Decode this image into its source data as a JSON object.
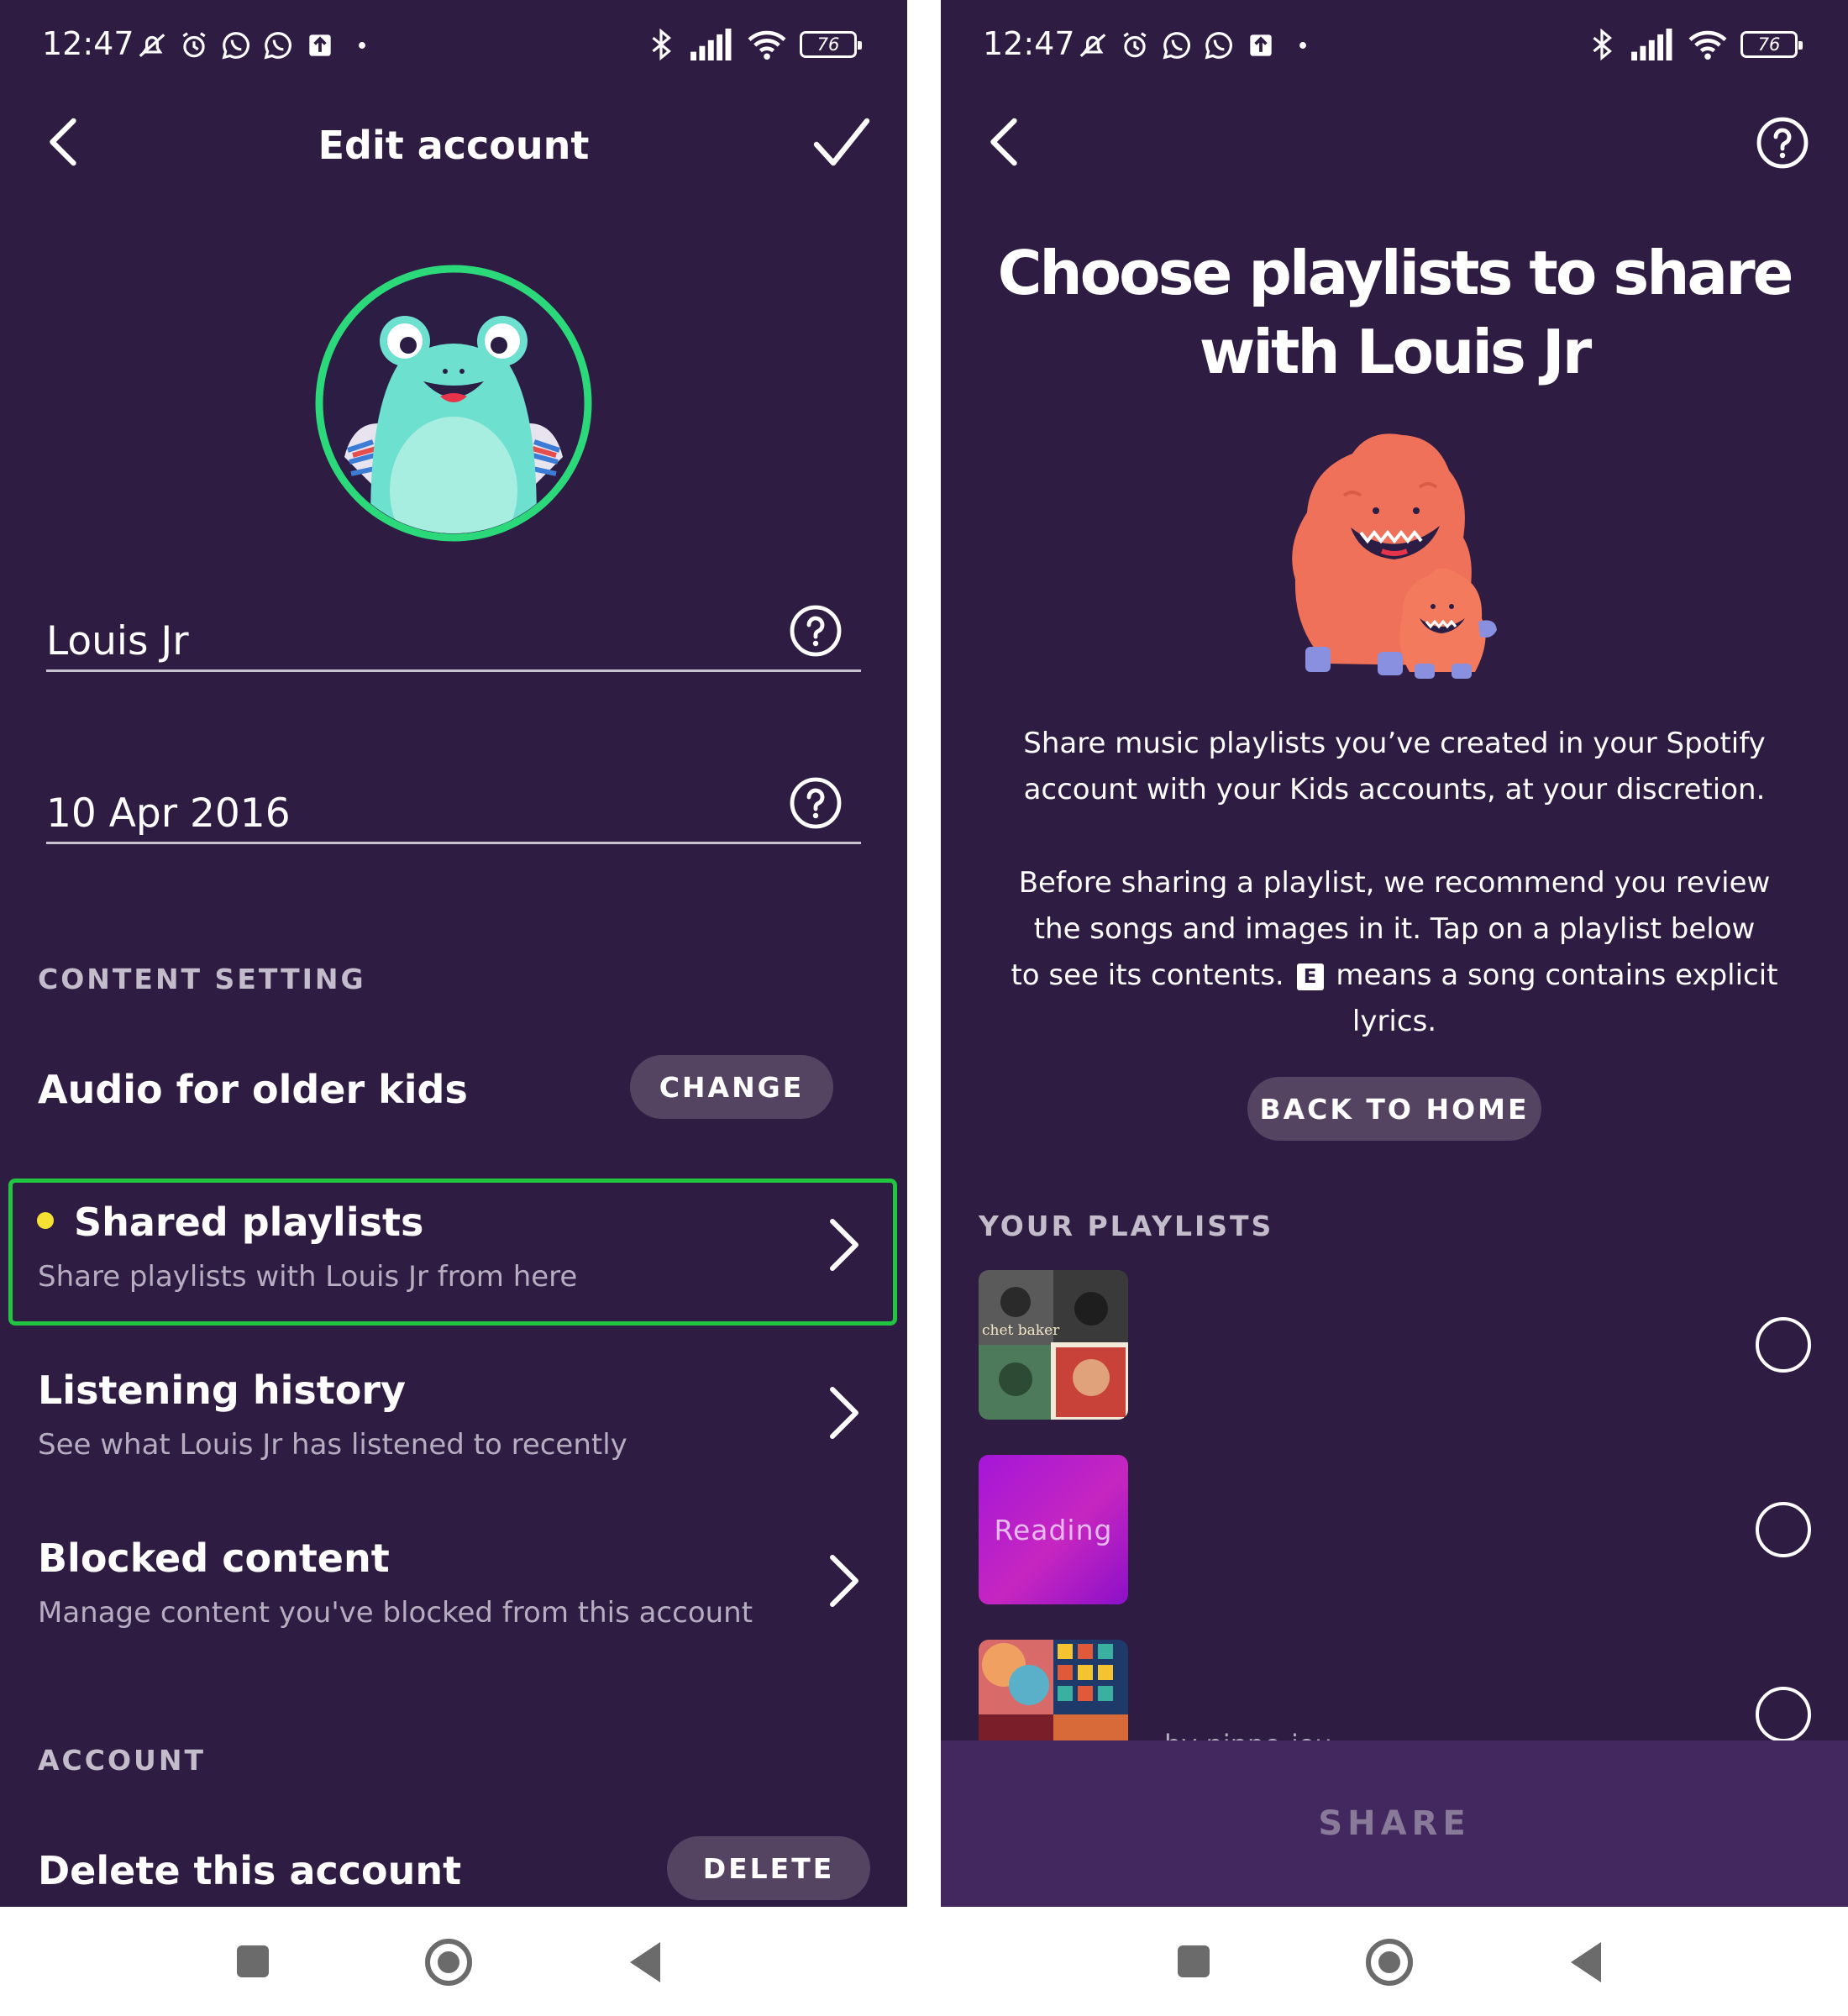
{
  "status_bar": {
    "time": "12:47",
    "battery": "76"
  },
  "edit_account": {
    "title": "Edit account",
    "name_value": "Louis Jr",
    "birthdate_value": "10 Apr 2016",
    "content_setting_header": "CONTENT SETTING",
    "content_level_label": "Audio for older kids",
    "change_button": "CHANGE",
    "shared_playlists": {
      "title": "Shared playlists",
      "subtitle": "Share playlists with Louis Jr from here"
    },
    "listening_history": {
      "title": "Listening history",
      "subtitle": "See what Louis Jr has listened to recently"
    },
    "blocked_content": {
      "title": "Blocked content",
      "subtitle": "Manage content you've blocked from this account"
    },
    "account_header": "ACCOUNT",
    "delete_label": "Delete this account",
    "delete_button": "DELETE"
  },
  "choose_playlists": {
    "headline_line1": "Choose playlists to share",
    "headline_line2": "with Louis Jr",
    "intro_line1": "Share music playlists you’ve created in your Spotify",
    "intro_line2": "account with your Kids accounts, at your discretion.",
    "review_line1": "Before sharing a playlist, we recommend you review",
    "review_line2": "the songs and images in it. Tap on a playlist below",
    "review_line3a": "to see its contents.",
    "explicit_badge": "E",
    "review_line3b": "means a song contains explicit",
    "review_line4": "lyrics.",
    "back_home_button": "BACK TO HOME",
    "playlists_header": "YOUR PLAYLISTS",
    "playlists": [
      {
        "cover_text": "chet baker",
        "owner": ""
      },
      {
        "cover_text": "Reading",
        "owner": ""
      },
      {
        "cover_text": "",
        "owner": "by nippo-iou"
      }
    ],
    "share_button": "SHARE"
  },
  "colors": {
    "background": "#2e1c42",
    "pill": "#544461",
    "highlight": "#21c540",
    "avatar_ring": "#2bd97a",
    "share_bar": "#432860"
  }
}
